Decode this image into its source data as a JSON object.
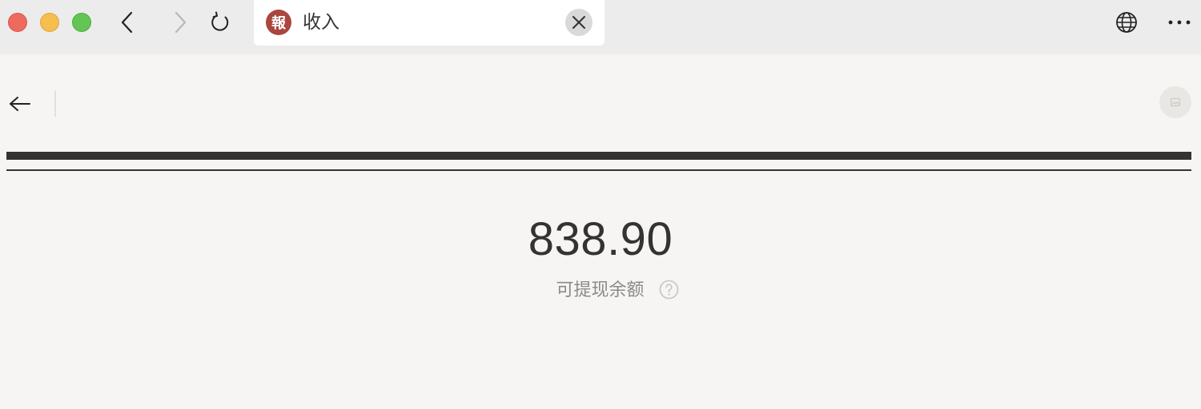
{
  "browser": {
    "tab": {
      "favicon_char": "報",
      "title": "收入",
      "favicon_color": "#a9473f"
    },
    "icons": {
      "back": "chevron-left-icon",
      "forward": "chevron-right-icon",
      "reload": "reload-icon",
      "close_tab": "close-icon",
      "globe": "globe-icon",
      "more": "more-horizontal-icon"
    },
    "traffic_lights": [
      "#ee6a5f",
      "#f5be4f",
      "#62c554"
    ]
  },
  "page": {
    "back_icon": "arrow-left-icon",
    "avatar_icon": "image-placeholder-icon",
    "balance": {
      "amount": "838.90",
      "label": "可提现余额",
      "help_icon": "question-circle-icon"
    },
    "colors": {
      "background": "#f6f5f3",
      "text_primary": "#333333",
      "text_secondary": "#8a8a8a"
    }
  }
}
